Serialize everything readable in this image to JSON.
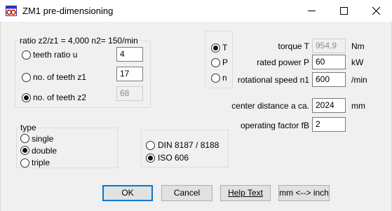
{
  "window": {
    "title": "ZM1 pre-dimensioning"
  },
  "colors": {
    "title_bar": "#ffffff",
    "dialog_bg": "#f0f0f0",
    "default_button_border": "#0078d7"
  },
  "ratio_group": {
    "label": "ratio z2/z1 = 4,000  n2= 150/min",
    "options": [
      {
        "label": "teeth ratio u",
        "value": "4",
        "checked": false,
        "enabled": true
      },
      {
        "label": "no. of teeth z1",
        "value": "17",
        "checked": false,
        "enabled": true
      },
      {
        "label": "no. of teeth z2",
        "value": "68",
        "checked": true,
        "enabled": false
      }
    ]
  },
  "calc_mode": {
    "options": [
      {
        "label": "T",
        "checked": true
      },
      {
        "label": "P",
        "checked": false
      },
      {
        "label": "n",
        "checked": false
      }
    ]
  },
  "params": {
    "torque": {
      "label": "torque T",
      "value": "954,9",
      "unit": "Nm",
      "enabled": false
    },
    "power": {
      "label": "rated power P",
      "value": "60",
      "unit": "kW",
      "enabled": true
    },
    "speed": {
      "label": "rotational speed n1",
      "value": "600",
      "unit": "/min",
      "enabled": true
    },
    "center_distance": {
      "label": "center distance a ca.",
      "value": "2024",
      "unit": "mm",
      "enabled": true
    },
    "operating_factor": {
      "label": "operating factor fB",
      "value": "2",
      "enabled": true
    }
  },
  "type_group": {
    "label": "type",
    "options": [
      {
        "label": "single",
        "checked": false
      },
      {
        "label": "double",
        "checked": true
      },
      {
        "label": "triple",
        "checked": false
      }
    ]
  },
  "standard_group": {
    "options": [
      {
        "label": "DIN 8187 / 8188",
        "checked": false
      },
      {
        "label": "ISO 606",
        "checked": true
      }
    ]
  },
  "buttons": {
    "ok": "OK",
    "cancel": "Cancel",
    "help": "Help Text",
    "units": "mm <--> inch"
  },
  "icons": {
    "app": "chain-app-icon",
    "minimize": "minimize-icon",
    "maximize": "maximize-icon",
    "close": "close-icon"
  }
}
